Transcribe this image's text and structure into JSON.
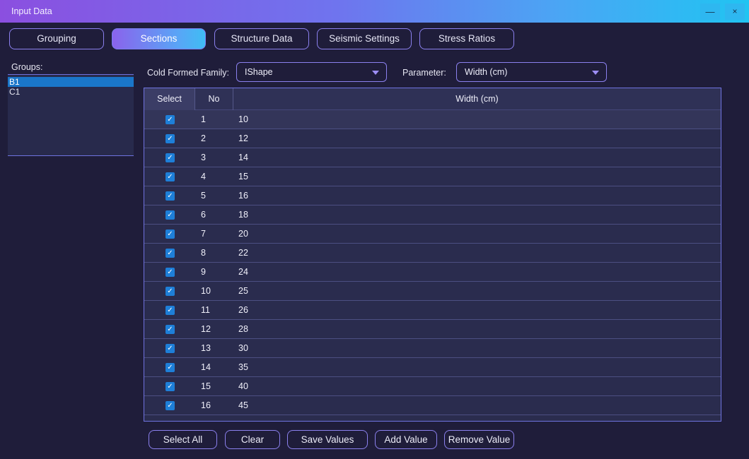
{
  "window": {
    "title": "Input Data",
    "minimize_glyph": "—",
    "close_glyph": "×"
  },
  "tabs": [
    {
      "label": "Grouping",
      "active": false
    },
    {
      "label": "Sections",
      "active": true
    },
    {
      "label": "Structure Data",
      "active": false
    },
    {
      "label": "Seismic Settings",
      "active": false
    },
    {
      "label": "Stress Ratios",
      "active": false
    }
  ],
  "groups": {
    "label": "Groups:",
    "items": [
      "B1",
      "C1"
    ],
    "selected": "B1"
  },
  "family": {
    "label": "Cold Formed Family:",
    "value": "IShape"
  },
  "parameter": {
    "label": "Parameter:",
    "value": "Width (cm)"
  },
  "table": {
    "columns": [
      "Select",
      "No",
      "Width (cm)"
    ],
    "rows": [
      {
        "checked": true,
        "no": "1",
        "value": "10"
      },
      {
        "checked": true,
        "no": "2",
        "value": "12"
      },
      {
        "checked": true,
        "no": "3",
        "value": "14"
      },
      {
        "checked": true,
        "no": "4",
        "value": "15"
      },
      {
        "checked": true,
        "no": "5",
        "value": "16"
      },
      {
        "checked": true,
        "no": "6",
        "value": "18"
      },
      {
        "checked": true,
        "no": "7",
        "value": "20"
      },
      {
        "checked": true,
        "no": "8",
        "value": "22"
      },
      {
        "checked": true,
        "no": "9",
        "value": "24"
      },
      {
        "checked": true,
        "no": "10",
        "value": "25"
      },
      {
        "checked": true,
        "no": "11",
        "value": "26"
      },
      {
        "checked": true,
        "no": "12",
        "value": "28"
      },
      {
        "checked": true,
        "no": "13",
        "value": "30"
      },
      {
        "checked": true,
        "no": "14",
        "value": "35"
      },
      {
        "checked": true,
        "no": "15",
        "value": "40"
      },
      {
        "checked": true,
        "no": "16",
        "value": "45"
      }
    ]
  },
  "buttons": {
    "select_all": "Select All",
    "clear": "Clear",
    "save_values": "Save Values",
    "add_value": "Add Value",
    "remove_value": "Remove Value"
  },
  "colors": {
    "accent": "#8b80ee",
    "selection": "#1a76c9",
    "checkbox": "#1e7fd8",
    "background": "#1f1d3a"
  },
  "icons": {
    "minimize": "minimize-icon",
    "close": "close-icon",
    "dropdown": "chevron-down-icon",
    "checkbox": "check-icon"
  }
}
